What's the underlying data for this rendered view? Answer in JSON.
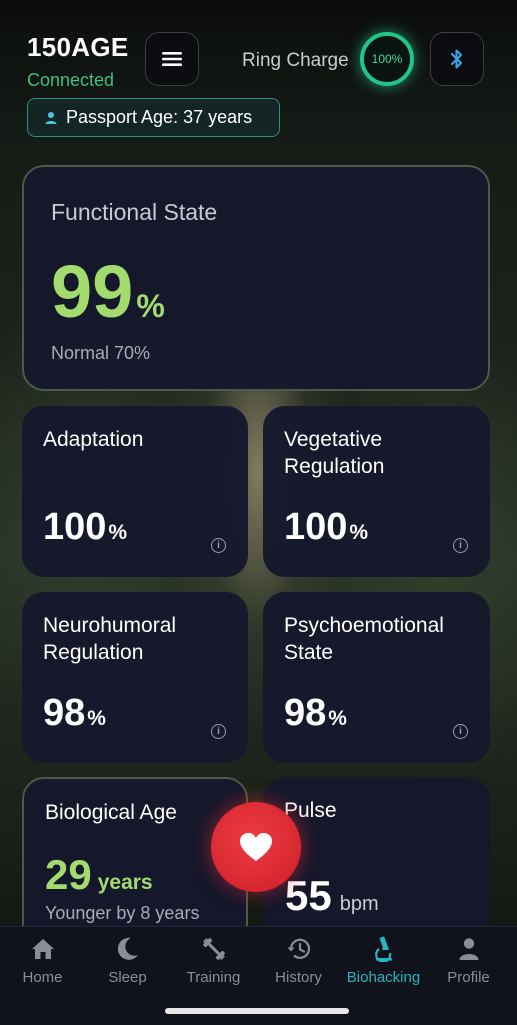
{
  "header": {
    "app_title": "150AGE",
    "connection_status": "Connected",
    "passport_age": "Passport Age: 37 years",
    "ring_charge_label": "Ring Charge",
    "ring_charge_value": "100%",
    "ring_charge_fraction": 1.0
  },
  "functional_state": {
    "title": "Functional State",
    "value": "99",
    "unit": "%",
    "normal": "Normal 70%"
  },
  "metrics": [
    {
      "title": "Adaptation",
      "value": "100",
      "unit": "%"
    },
    {
      "title": "Vegetative Regulation",
      "value": "100",
      "unit": "%"
    },
    {
      "title": "Neurohumoral Regulation",
      "value": "98",
      "unit": "%"
    },
    {
      "title": "Psychoemotional State",
      "value": "98",
      "unit": "%"
    }
  ],
  "biological_age": {
    "title": "Biological Age",
    "value": "29",
    "unit": "years",
    "subtitle": "Younger by 8 years"
  },
  "pulse": {
    "title": "Pulse",
    "value": "55",
    "unit": "bpm"
  },
  "nav": {
    "items": [
      {
        "label": "Home",
        "icon": "home-icon"
      },
      {
        "label": "Sleep",
        "icon": "moon-icon"
      },
      {
        "label": "Training",
        "icon": "dumbbell-icon"
      },
      {
        "label": "History",
        "icon": "history-icon"
      },
      {
        "label": "Biohacking",
        "icon": "microscope-icon"
      },
      {
        "label": "Profile",
        "icon": "person-icon"
      }
    ],
    "active": "Biohacking"
  },
  "colors": {
    "accent_green": "#a4db6e",
    "connected_green": "#3fbf7f",
    "ring_green": "#22c48a",
    "active_teal": "#27b3c2",
    "heart_red": "#e02a33",
    "card_bg": "#16182c"
  }
}
